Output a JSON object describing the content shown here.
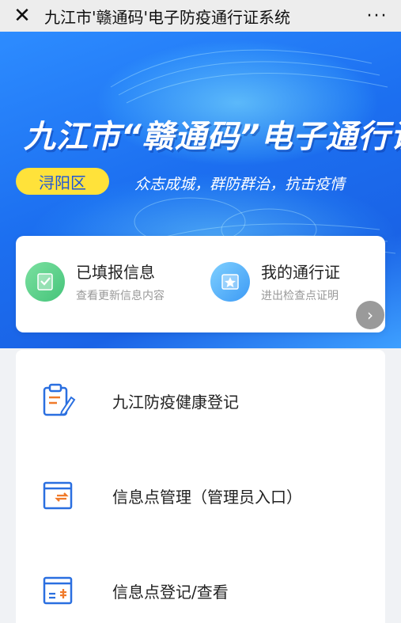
{
  "topbar": {
    "close_icon": "close-icon",
    "title": "九江市'赣通码'电子防疫通行证系统",
    "more_label": "···"
  },
  "banner": {
    "title": "九江市“赣通码”电子通行证",
    "district": "浔阳区",
    "slogan": "众志成城，群防群治，抗击疫情"
  },
  "quick_entries": [
    {
      "title": "已填报信息",
      "subtitle": "查看更新信息内容",
      "icon": "checklist-icon",
      "color": "#45c47a"
    },
    {
      "title": "我的通行证",
      "subtitle": "进出检查点证明",
      "icon": "star-badge-icon",
      "color": "#3c9af5"
    }
  ],
  "next_icon": "chevron-right-icon",
  "menu": [
    {
      "label": "九江防疫健康登记",
      "icon": "clipboard-edit-icon"
    },
    {
      "label": "信息点管理（管理员入口）",
      "icon": "card-exchange-icon"
    },
    {
      "label": "信息点登记/查看",
      "icon": "card-list-icon"
    }
  ],
  "colors": {
    "accent": "#1c6ff0",
    "badge": "#ffe23a",
    "icon_orange": "#f07a2a",
    "icon_blue": "#2a6fe0"
  }
}
